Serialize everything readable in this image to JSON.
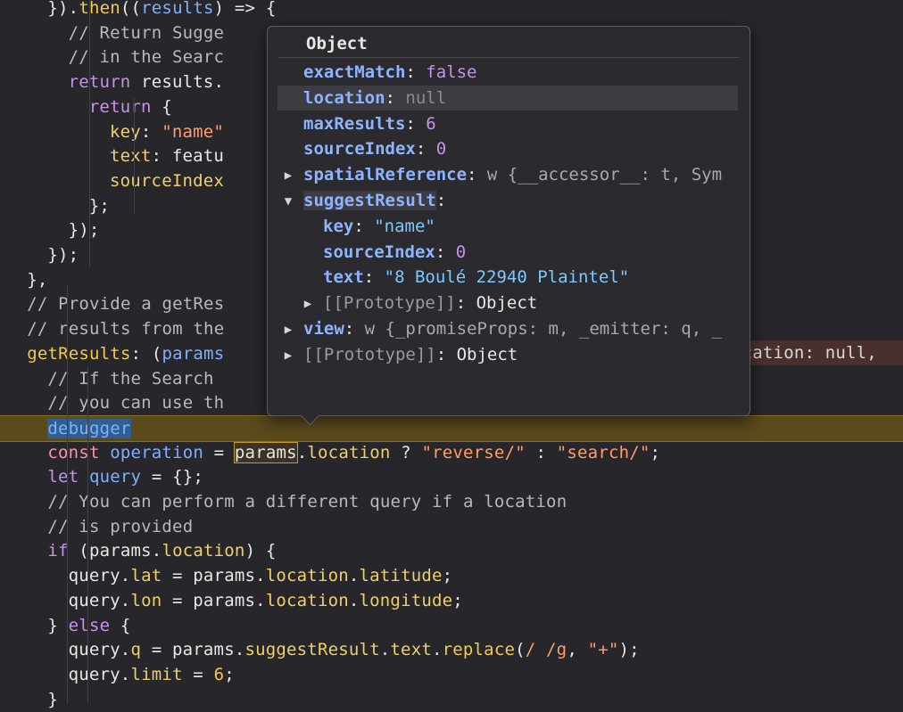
{
  "code_lines": [
    {
      "indent": "    ",
      "tokens": [
        [
          "plain",
          "})."
        ],
        [
          "fn",
          "then"
        ],
        [
          "plain",
          "(("
        ],
        [
          "var",
          "results"
        ],
        [
          "plain",
          ") => {"
        ]
      ]
    },
    {
      "indent": "      ",
      "tokens": [
        [
          "com",
          "// Return Sugge"
        ]
      ]
    },
    {
      "indent": "      ",
      "tokens": [
        [
          "com",
          "// in the Searc"
        ]
      ]
    },
    {
      "indent": "      ",
      "tokens": [
        [
          "kw",
          "return"
        ],
        [
          "plain",
          " results."
        ]
      ]
    },
    {
      "indent": "        ",
      "tokens": [
        [
          "kw",
          "return"
        ],
        [
          "plain",
          " {"
        ]
      ]
    },
    {
      "indent": "          ",
      "tokens": [
        [
          "prop",
          "key"
        ],
        [
          "plain",
          ": "
        ],
        [
          "str",
          "\"name\""
        ]
      ]
    },
    {
      "indent": "          ",
      "tokens": [
        [
          "prop",
          "text"
        ],
        [
          "plain",
          ": featu"
        ]
      ]
    },
    {
      "indent": "          ",
      "tokens": [
        [
          "prop",
          "sourceIndex"
        ]
      ]
    },
    {
      "indent": "        ",
      "tokens": [
        [
          "plain",
          "};"
        ]
      ]
    },
    {
      "indent": "      ",
      "tokens": [
        [
          "plain",
          "});"
        ]
      ]
    },
    {
      "indent": "    ",
      "tokens": [
        [
          "plain",
          "});"
        ]
      ]
    },
    {
      "indent": "  ",
      "tokens": [
        [
          "plain",
          "},"
        ]
      ]
    },
    {
      "indent": "  ",
      "tokens": [
        [
          "com",
          "// Provide a getRes"
        ]
      ]
    },
    {
      "indent": "  ",
      "tokens": [
        [
          "com",
          "// results from the"
        ]
      ]
    },
    {
      "indent": "  ",
      "tokens": [
        [
          "fn",
          "getResults"
        ],
        [
          "plain",
          ": ("
        ],
        [
          "var",
          "params"
        ]
      ]
    },
    {
      "indent": "    ",
      "tokens": [
        [
          "com",
          "// If the Search"
        ]
      ]
    },
    {
      "indent": "    ",
      "tokens": [
        [
          "com",
          "// you can use th"
        ]
      ]
    },
    {
      "indent": "    ",
      "tokens": [
        [
          "debugger",
          "debugger"
        ]
      ]
    },
    {
      "indent": "    ",
      "tokens": [
        [
          "kw2",
          "const"
        ],
        [
          "plain",
          " "
        ],
        [
          "var",
          "operation"
        ],
        [
          "plain",
          " = "
        ],
        [
          "params",
          "params"
        ],
        [
          "plain",
          "."
        ],
        [
          "prop",
          "location"
        ],
        [
          "plain",
          " ? "
        ],
        [
          "str",
          "\"reverse/\""
        ],
        [
          "plain",
          " : "
        ],
        [
          "str",
          "\"search/\""
        ],
        [
          "plain",
          ";"
        ]
      ]
    },
    {
      "indent": "    ",
      "tokens": [
        [
          "kw",
          "let"
        ],
        [
          "plain",
          " "
        ],
        [
          "var",
          "query"
        ],
        [
          "plain",
          " = {};"
        ]
      ]
    },
    {
      "indent": "    ",
      "tokens": [
        [
          "com",
          "// You can perform a different query if a location"
        ]
      ]
    },
    {
      "indent": "    ",
      "tokens": [
        [
          "com",
          "// is provided"
        ]
      ]
    },
    {
      "indent": "    ",
      "tokens": [
        [
          "kw",
          "if"
        ],
        [
          "plain",
          " (params."
        ],
        [
          "prop",
          "location"
        ],
        [
          "plain",
          ") {"
        ]
      ]
    },
    {
      "indent": "      ",
      "tokens": [
        [
          "plain",
          "query."
        ],
        [
          "prop",
          "lat"
        ],
        [
          "plain",
          " = params."
        ],
        [
          "prop",
          "location"
        ],
        [
          "plain",
          "."
        ],
        [
          "prop",
          "latitude"
        ],
        [
          "plain",
          ";"
        ]
      ]
    },
    {
      "indent": "      ",
      "tokens": [
        [
          "plain",
          "query."
        ],
        [
          "prop",
          "lon"
        ],
        [
          "plain",
          " = params."
        ],
        [
          "prop",
          "location"
        ],
        [
          "plain",
          "."
        ],
        [
          "prop",
          "longitude"
        ],
        [
          "plain",
          ";"
        ]
      ]
    },
    {
      "indent": "    ",
      "tokens": [
        [
          "plain",
          "} "
        ],
        [
          "kw",
          "else"
        ],
        [
          "plain",
          " {"
        ]
      ]
    },
    {
      "indent": "      ",
      "tokens": [
        [
          "plain",
          "query."
        ],
        [
          "prop",
          "q"
        ],
        [
          "plain",
          " = params."
        ],
        [
          "prop",
          "suggestResult"
        ],
        [
          "plain",
          "."
        ],
        [
          "prop",
          "text"
        ],
        [
          "plain",
          "."
        ],
        [
          "fn",
          "replace"
        ],
        [
          "plain",
          "("
        ],
        [
          "str",
          "/ /g"
        ],
        [
          "plain",
          ", "
        ],
        [
          "str",
          "\"+\""
        ],
        [
          "plain",
          ");"
        ]
      ]
    },
    {
      "indent": "      ",
      "tokens": [
        [
          "plain",
          "query."
        ],
        [
          "prop",
          "limit"
        ],
        [
          "plain",
          " = "
        ],
        [
          "num",
          "6"
        ],
        [
          "plain",
          ";"
        ]
      ]
    },
    {
      "indent": "    ",
      "tokens": [
        [
          "plain",
          "}"
        ]
      ]
    }
  ],
  "right_overflow_text": "ocation: null,",
  "popup": {
    "title": "Object",
    "rows": [
      {
        "key": "exactMatch",
        "sep": ": ",
        "val": "false",
        "vclass": "pval-bool",
        "toggle": ""
      },
      {
        "key": "location",
        "sep": ": ",
        "val": "null",
        "vclass": "pval-null",
        "toggle": "",
        "highlight": true
      },
      {
        "key": "maxResults",
        "sep": ": ",
        "val": "6",
        "vclass": "pval-num",
        "toggle": ""
      },
      {
        "key": "sourceIndex",
        "sep": ": ",
        "val": "0",
        "vclass": "pval-num",
        "toggle": ""
      },
      {
        "key": "spatialReference",
        "sep": ": ",
        "val": "w {__accessor__: t, Sym",
        "vclass": "pval-dim",
        "toggle": "▶"
      },
      {
        "key": "suggestResult",
        "sep": ":",
        "val": "",
        "vclass": "pval-dim",
        "toggle": "▼",
        "keyhl": true
      },
      {
        "key": "key",
        "sep": ": ",
        "val": "\"name\"",
        "vclass": "pval-str",
        "toggle": "",
        "nested": true
      },
      {
        "key": "sourceIndex",
        "sep": ": ",
        "val": "0",
        "vclass": "pval-num",
        "toggle": "",
        "nested": true
      },
      {
        "key": "text",
        "sep": ": ",
        "val": "\"8 Boulé 22940 Plaintel\"",
        "vclass": "pval-str",
        "toggle": "",
        "nested": true
      },
      {
        "key": "[[Prototype]]",
        "sep": ": ",
        "val": "Object",
        "vclass": "plain",
        "toggle": "▶",
        "nested": true,
        "gray": true
      },
      {
        "key": "view",
        "sep": ": ",
        "val": "w {_promiseProps: m, _emitter: q, _",
        "vclass": "pval-dim",
        "toggle": "▶"
      },
      {
        "key": "[[Prototype]]",
        "sep": ": ",
        "val": "Object",
        "vclass": "plain",
        "toggle": "▶",
        "gray": true
      }
    ]
  }
}
